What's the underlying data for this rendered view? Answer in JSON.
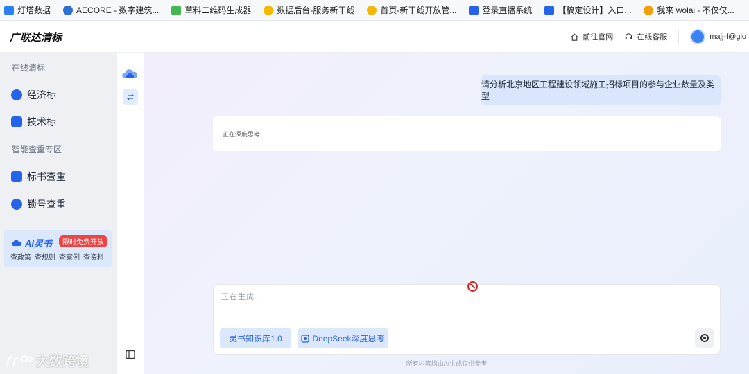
{
  "bookmarks": [
    {
      "label": "灯塔数据",
      "icon": "grid-icon",
      "color": "#2d7ff9"
    },
    {
      "label": "AECORE - 数字建筑...",
      "icon": "aecore-icon",
      "color": "#2c6fd6"
    },
    {
      "label": "草料二维码生成器",
      "icon": "qr-icon",
      "color": "#3fb950"
    },
    {
      "label": "数据后台-服务新干线",
      "icon": "bulb-icon",
      "color": "#f5b800"
    },
    {
      "label": "首页-新干线开放管...",
      "icon": "bulb-icon",
      "color": "#f5b800"
    },
    {
      "label": "登录直播系统",
      "icon": "video-icon",
      "color": "#2563eb"
    },
    {
      "label": "【稿定设计】入口...",
      "icon": "gaoding-icon",
      "color": "#2563eb"
    },
    {
      "label": "我来 wolai - 不仅仅...",
      "icon": "wolai-icon",
      "color": "#f59e0b"
    }
  ],
  "header": {
    "brand": "广联达清标",
    "official_site": "前往官网",
    "online_service": "在线客服",
    "username": "majj-f@glo"
  },
  "sidebar": {
    "section1_title": "在线清标",
    "items1": [
      {
        "label": "经济标",
        "icon": "economic-bid-icon"
      },
      {
        "label": "技术标",
        "icon": "technical-bid-icon"
      }
    ],
    "section2_title": "智能查重专区",
    "items2": [
      {
        "label": "标书查重",
        "icon": "bid-check-icon"
      },
      {
        "label": "锁号查重",
        "icon": "lock-check-icon"
      }
    ],
    "ai_card": {
      "title": "AI灵书",
      "badge": "限时免费开放",
      "tags": [
        "查政策",
        "查规则",
        "查案例",
        "查资料"
      ]
    }
  },
  "chat": {
    "user_message": "请分析北京地区工程建设领域施工招标项目的参与企业数量及类型",
    "answer_status": "正在深度思考",
    "composer_placeholder": "正在生成...",
    "chip1": "灵书知识库1.0",
    "chip2": "DeepSeek深度思考",
    "disclaimer": "所有内容均由AI生成仅供参考"
  },
  "watermark": "大数跨境",
  "colors": {
    "accent": "#2563eb",
    "badge": "#ef4444",
    "sidebar_bg": "#eef0f4",
    "bubble_bg": "#d9e6fb"
  }
}
